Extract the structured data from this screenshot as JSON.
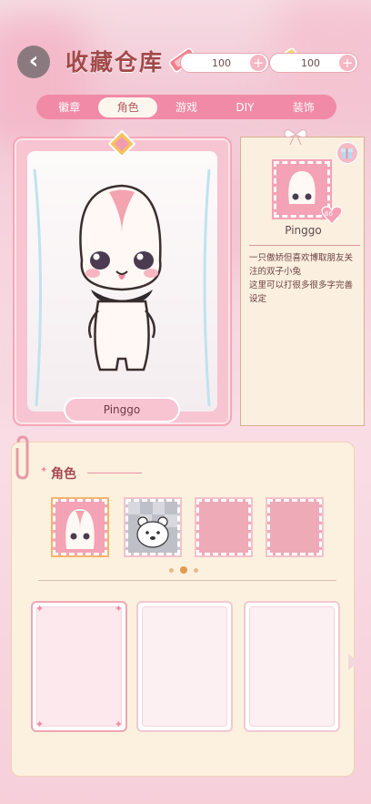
{
  "header": {
    "title": "收藏仓库",
    "currency": [
      {
        "icon": "ticket-icon",
        "value": "100"
      },
      {
        "icon": "coupon-icon",
        "value": "100"
      }
    ],
    "plus_symbol": "+",
    "back_symbol": "‹"
  },
  "tabs": [
    {
      "label": "徽章",
      "active": false
    },
    {
      "label": "角色",
      "active": true
    },
    {
      "label": "游戏",
      "active": false
    },
    {
      "label": "DIY",
      "active": false
    },
    {
      "label": "装饰",
      "active": false
    }
  ],
  "character": {
    "name": "Pinggo",
    "badge_count": "66",
    "description": "一只傲娇但喜欢博取朋友关注的双子小兔\n这里可以打很多很多字完善设定"
  },
  "collection": {
    "section_title": "角色",
    "slots": [
      {
        "icon": "bunny-icon",
        "selected": true
      },
      {
        "icon": "bear-icon",
        "selected": false
      },
      {
        "icon": "empty",
        "selected": false
      },
      {
        "icon": "empty",
        "selected": false
      }
    ],
    "page_count": 3,
    "current_page": 2
  },
  "colors": {
    "accent": "#f08aa6",
    "title": "#a24a4a"
  }
}
